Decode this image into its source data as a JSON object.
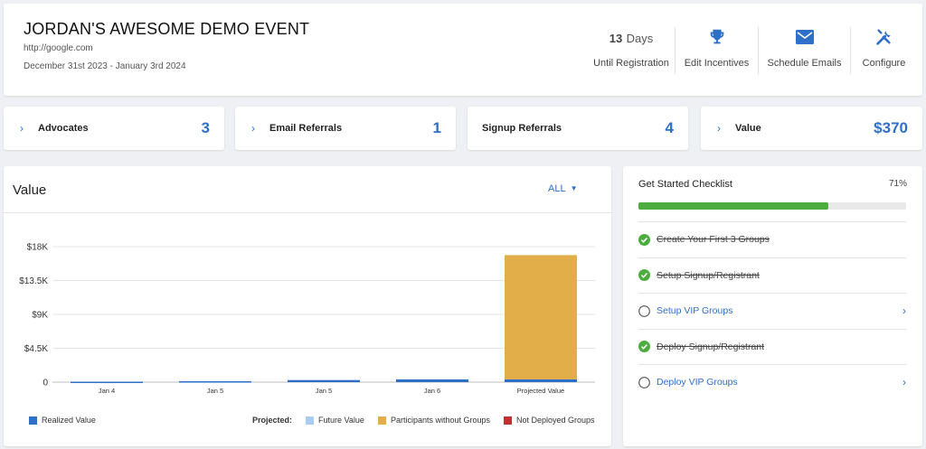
{
  "event": {
    "title": "JORDAN'S AWESOME DEMO EVENT",
    "url": "http://google.com",
    "dates": "December 31st 2023 - January 3rd 2024"
  },
  "countdown": {
    "number": "13",
    "unit": "Days",
    "label": "Until Registration"
  },
  "actions": [
    {
      "label": "Edit Incentives",
      "icon": "trophy-icon"
    },
    {
      "label": "Schedule Emails",
      "icon": "envelope-icon"
    },
    {
      "label": "Configure",
      "icon": "tools-icon"
    }
  ],
  "stats": [
    {
      "label": "Advocates",
      "value": "3",
      "has_chevron": true
    },
    {
      "label": "Email Referrals",
      "value": "1",
      "has_chevron": true
    },
    {
      "label": "Signup Referrals",
      "value": "4",
      "has_chevron": false
    },
    {
      "label": "Value",
      "value": "$370",
      "has_chevron": true
    }
  ],
  "value_panel": {
    "title": "Value",
    "filter": "ALL"
  },
  "chart_data": {
    "type": "bar",
    "stacked": true,
    "categories": [
      "Jan 4",
      "Jan 5",
      "Jan 5",
      "Jan 6",
      "Projected Value"
    ],
    "series": [
      {
        "name": "Realized Value",
        "color": "#2e6fc8",
        "values": [
          60,
          120,
          280,
          370,
          370
        ]
      },
      {
        "name": "Future Value",
        "color": "#a9ccf1",
        "values": [
          0,
          0,
          0,
          0,
          0
        ]
      },
      {
        "name": "Participants without Groups",
        "color": "#e1ae4a",
        "values": [
          0,
          0,
          0,
          0,
          16500
        ]
      },
      {
        "name": "Not Deployed Groups",
        "color": "#c52f2f",
        "values": [
          0,
          0,
          0,
          0,
          0
        ]
      }
    ],
    "yticks": [
      0,
      4500,
      9000,
      13500,
      18000
    ],
    "ytick_labels": [
      "0",
      "$4.5K",
      "$9K",
      "$13.5K",
      "$18K"
    ],
    "ylim": [
      0,
      18000
    ],
    "grid": true,
    "legend_position": "bottom",
    "legend_group_label": "Projected:"
  },
  "checklist": {
    "title": "Get Started Checklist",
    "percent_label": "71%",
    "progress": 0.71,
    "items": [
      {
        "label": "Create Your First 3 Groups",
        "done": true
      },
      {
        "label": "Setup Signup/Registrant",
        "done": true
      },
      {
        "label": "Setup VIP Groups",
        "done": false
      },
      {
        "label": "Deploy Signup/Registrant",
        "done": true
      },
      {
        "label": "Deploy VIP Groups",
        "done": false
      }
    ]
  }
}
